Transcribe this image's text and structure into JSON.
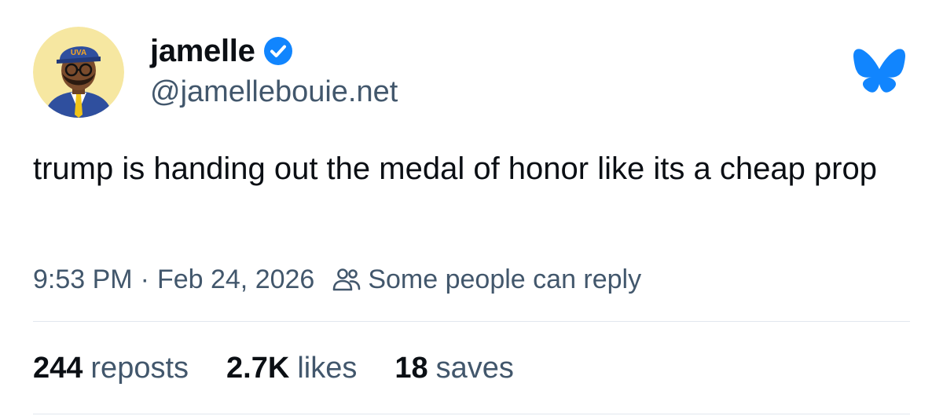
{
  "author": {
    "display_name": "jamelle",
    "handle": "@jamellebouie.net",
    "avatar_cap_text": "UVA"
  },
  "icons": {
    "verified": "verified-check-icon",
    "logo": "bluesky-butterfly-icon",
    "reply_audience": "people-icon"
  },
  "post": {
    "text": "trump is handing out the medal of honor like its a cheap prop"
  },
  "meta": {
    "time": "9:53 PM",
    "separator": "·",
    "date": "Feb 24, 2026",
    "reply_setting": "Some people can reply"
  },
  "stats": {
    "reposts_count": "244",
    "reposts_label": "reposts",
    "likes_count": "2.7K",
    "likes_label": "likes",
    "saves_count": "18",
    "saves_label": "saves"
  },
  "colors": {
    "accent": "#1185fe",
    "text_primary": "#0b0f14",
    "text_secondary": "#42576c",
    "divider": "#e2e7ee"
  }
}
